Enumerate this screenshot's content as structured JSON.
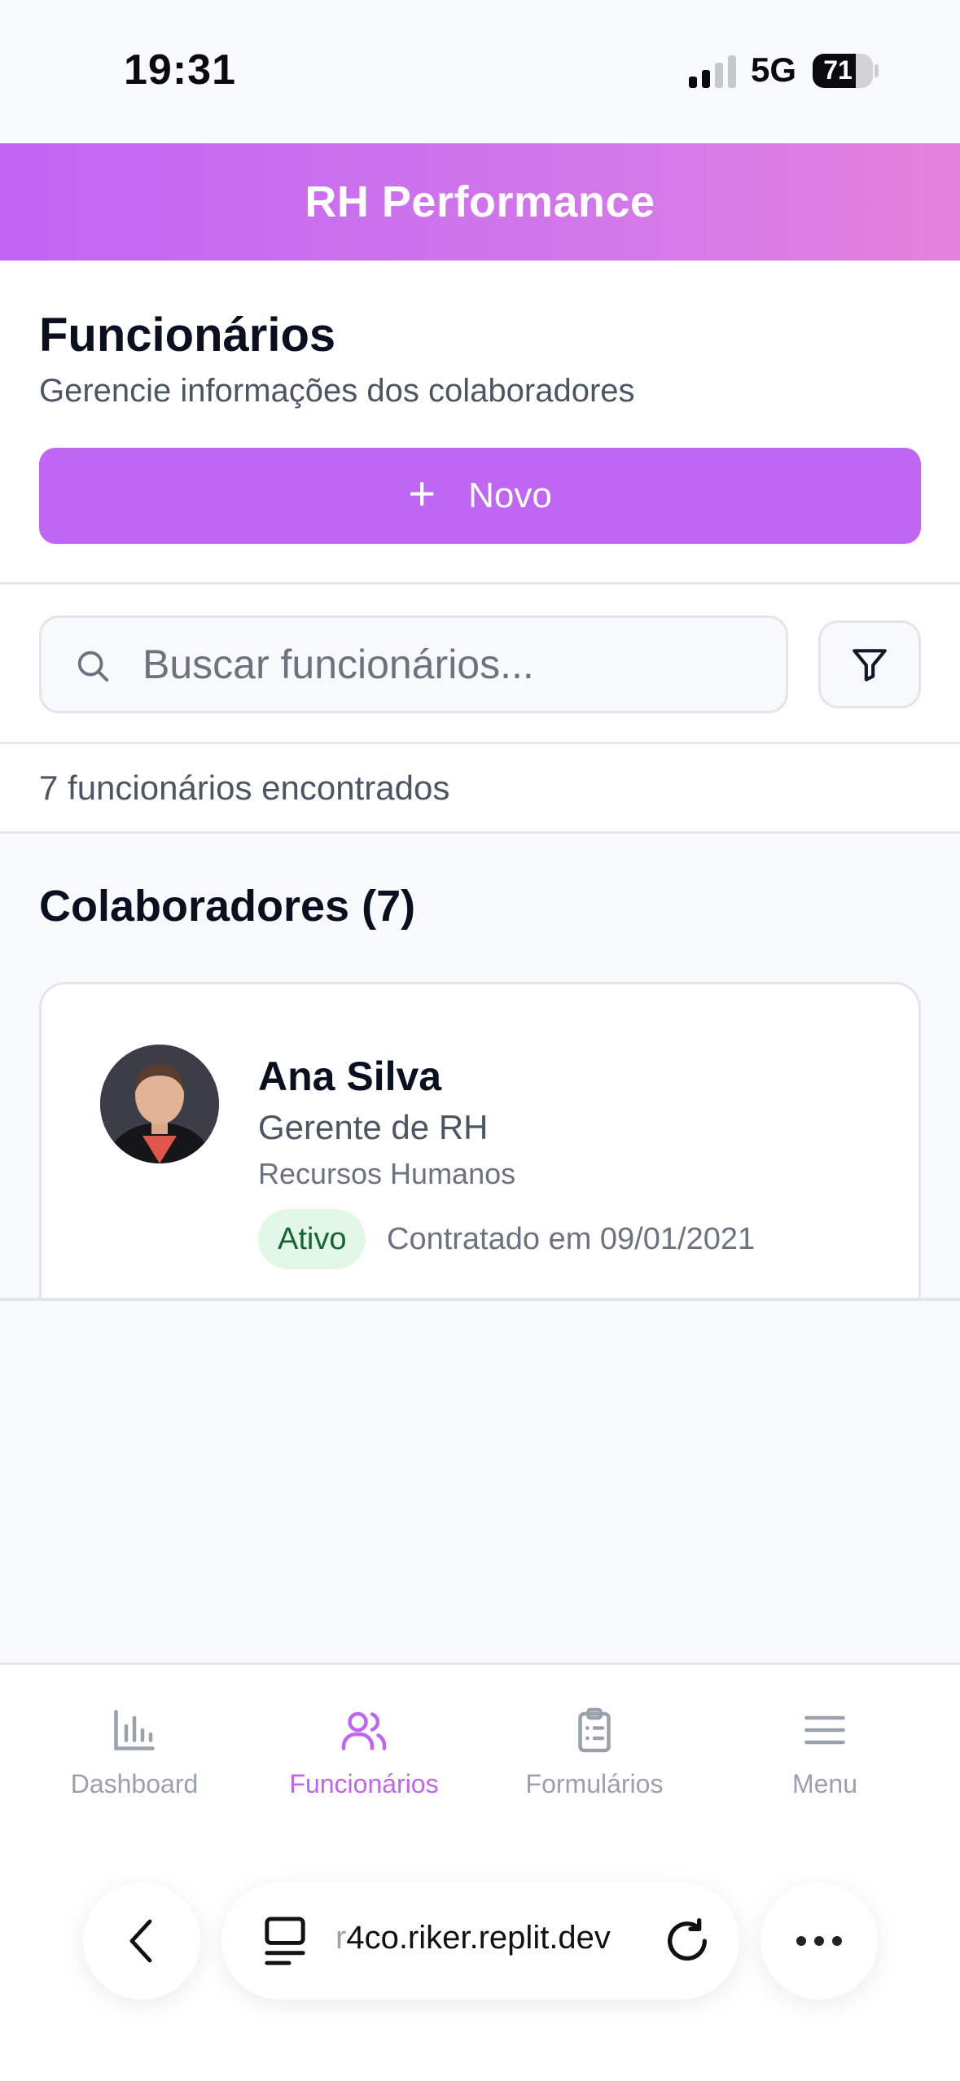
{
  "status_bar": {
    "time": "19:31",
    "network": "5G",
    "battery": "71",
    "battery_level": 0.71
  },
  "app": {
    "title": "RH Performance"
  },
  "page": {
    "title": "Funcionários",
    "subtitle": "Gerencie informações dos colaboradores",
    "new_button_label": "Novo"
  },
  "search": {
    "placeholder": "Buscar funcionários..."
  },
  "results": {
    "count_text": "7 funcionários encontrados"
  },
  "list": {
    "title": "Colaboradores (7)",
    "employees": [
      {
        "name": "Ana Silva",
        "role": "Gerente de RH",
        "department": "Recursos Humanos",
        "status": "Ativo",
        "hired_text": "Contratado em 09/01/2021"
      }
    ]
  },
  "bottom_nav": {
    "items": [
      {
        "label": "Dashboard",
        "icon": "bar-chart-icon"
      },
      {
        "label": "Funcionários",
        "icon": "users-icon",
        "active": true
      },
      {
        "label": "Formulários",
        "icon": "clipboard-icon"
      },
      {
        "label": "Menu",
        "icon": "hamburger-menu-icon"
      }
    ]
  },
  "browser": {
    "url_prefix": "r",
    "url_rest": "4co.riker.replit.dev"
  },
  "colors": {
    "accent": "#bf66f4",
    "active_badge_bg": "#e3f7e8",
    "active_badge_text": "#166534"
  }
}
